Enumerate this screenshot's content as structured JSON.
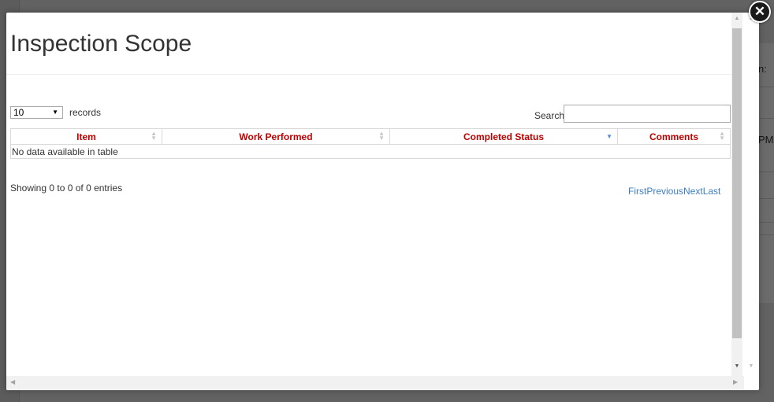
{
  "background": {
    "right_texts": [
      "n:",
      "PM"
    ]
  },
  "modal": {
    "title": "Inspection Scope",
    "close_icon": "close-circle-icon"
  },
  "table_controls": {
    "length_value": "10",
    "length_label": "records",
    "search_label": "Search:",
    "search_value": ""
  },
  "table": {
    "columns": [
      "Item",
      "Work Performed",
      "Completed Status",
      "Comments"
    ],
    "sorted_column": "Completed Status",
    "empty_message": "No data available in table"
  },
  "footer": {
    "info": "Showing 0 to 0 of 0 entries",
    "pager": {
      "first": "First",
      "previous": "Previous",
      "next": "Next",
      "last": "Last"
    }
  },
  "colors": {
    "header_text": "#c00000",
    "link": "#3c7ec4",
    "sort_active": "#4e8fd1"
  }
}
